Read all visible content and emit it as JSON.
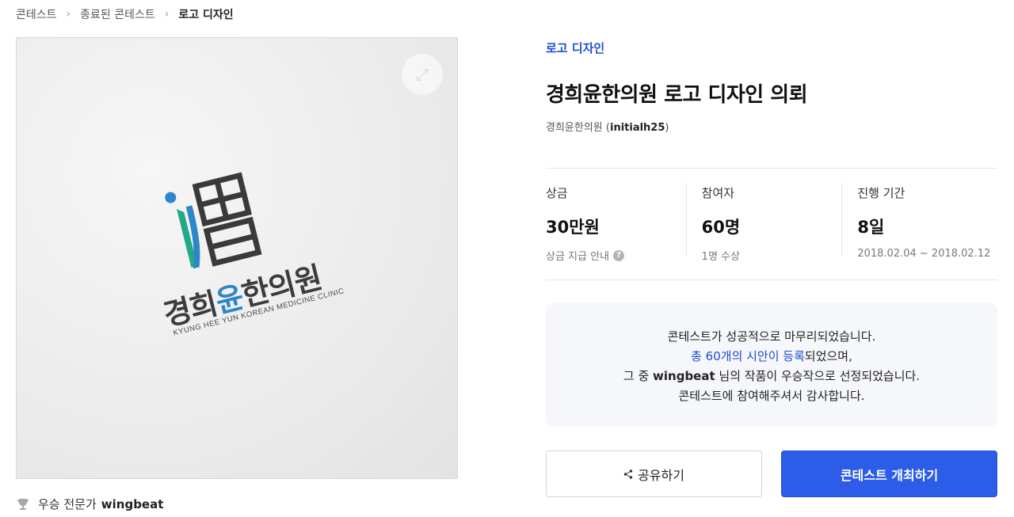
{
  "breadcrumb": {
    "items": [
      "콘테스트",
      "종료된 콘테스트",
      "로고 디자인"
    ],
    "separator": ">"
  },
  "image": {
    "logo_text_1": "경희",
    "logo_text_accent": "윤",
    "logo_text_2": "한의원",
    "logo_subtext": "KYUNG HEE YUN KOREAN MEDICINE CLINIC"
  },
  "winner": {
    "label": "우승 전문가",
    "name": "wingbeat",
    "icon": "trophy-icon"
  },
  "contest": {
    "category": "로고 디자인",
    "title": "경희윤한의원 로고 디자인 의뢰",
    "host_name": "경희윤한의원",
    "host_id_open": "(",
    "host_id": "initialh25",
    "host_id_close": ")"
  },
  "stats": {
    "prize": {
      "label": "상금",
      "value": "30만원",
      "sub": "상금 지급 안내",
      "help": "?"
    },
    "participants": {
      "label": "참여자",
      "value": "60명",
      "sub": "1명 수상"
    },
    "duration": {
      "label": "진행 기간",
      "value": "8일",
      "sub": "2018.02.04 ~ 2018.02.12"
    }
  },
  "notice": {
    "line1": "콘테스트가 성공적으로 마무리되었습니다.",
    "line2_link": "총 60개의 시안이 등록",
    "line2_rest": "되었으며,",
    "line3_pre": "그 중 ",
    "line3_name": "wingbeat",
    "line3_post": " 님의 작품이 우승작으로 선정되었습니다.",
    "line4": "콘테스트에 참여해주셔서 감사합니다."
  },
  "buttons": {
    "share_label": "공유하기",
    "host_label": "콘테스트 개최하기"
  },
  "colors": {
    "accent": "#2d5ce8",
    "link": "#1f4ecf",
    "logo_blue": "#2c86c9",
    "logo_green": "#23a987"
  }
}
